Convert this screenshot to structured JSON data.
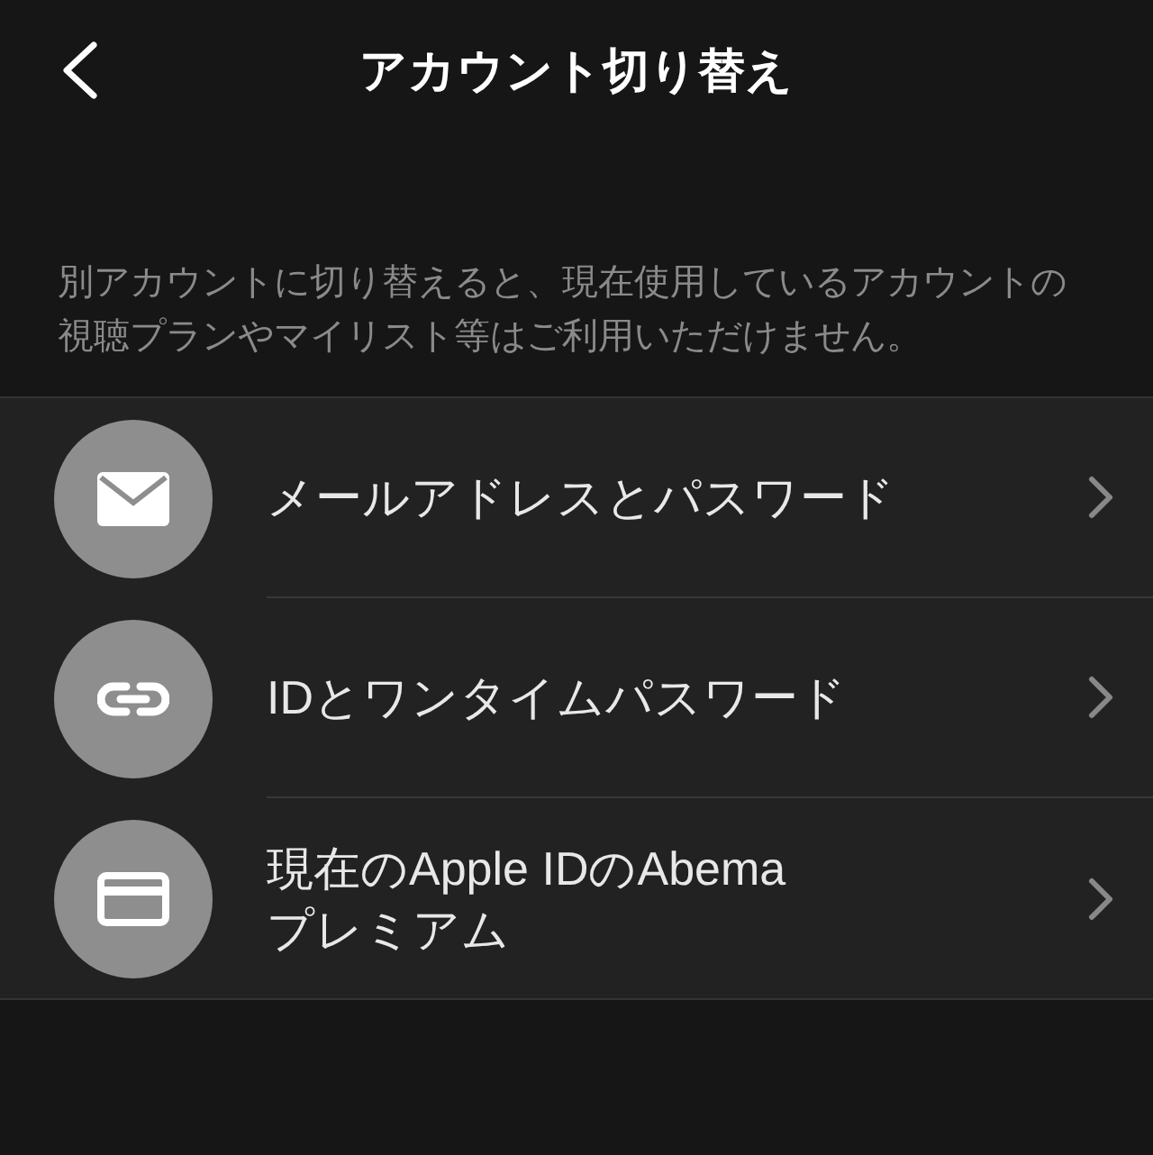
{
  "header": {
    "title": "アカウント切り替え"
  },
  "description": "別アカウントに切り替えると、現在使用しているアカウントの視聴プランやマイリスト等はご利用いただけません。",
  "options": [
    {
      "kind": "mail",
      "label": "メールアドレスとパスワード"
    },
    {
      "kind": "link",
      "label": "IDとワンタイムパスワード"
    },
    {
      "kind": "card",
      "label": "現在のApple IDのAbema\nプレミアム"
    }
  ]
}
